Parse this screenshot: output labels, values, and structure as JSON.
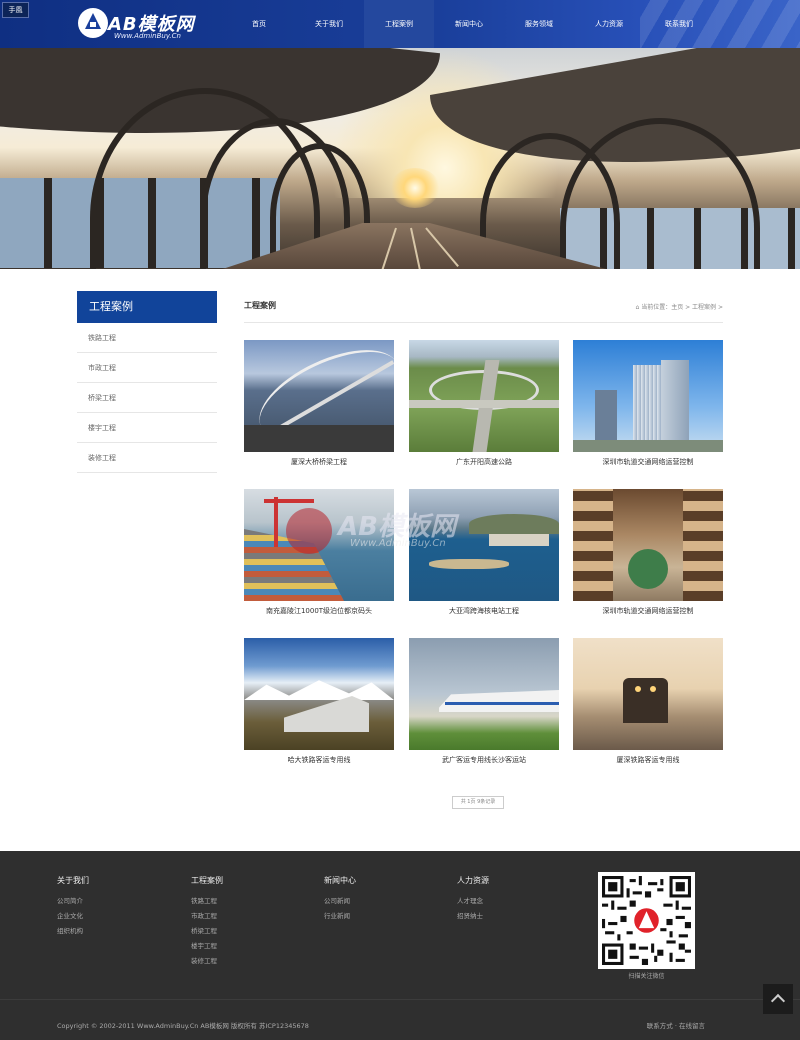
{
  "header": {
    "mobile_menu_label": "手風",
    "logo_name": "AB模板网",
    "logo_url": "Www.AdminBuy.Cn",
    "nav": [
      "首页",
      "关于我们",
      "工程案例",
      "新闻中心",
      "服务领域",
      "人力资源",
      "联系我们"
    ],
    "active_nav": "工程案例",
    "brand_color": "#1a3f9b"
  },
  "sidebar": {
    "title": "工程案例",
    "items": [
      "铁路工程",
      "市政工程",
      "桥梁工程",
      "楼宇工程",
      "装修工程"
    ]
  },
  "content": {
    "title": "工程案例",
    "breadcrumb": "当前位置：主页 > 工程案例 >",
    "cases": [
      "厦深大桥桥梁工程",
      "广东开阳高速公路",
      "深圳市轨道交通网络运营控制",
      "南充嘉陵江1000T级泊位都京码头",
      "大亚湾跨海核电站工程",
      "深圳市轨道交通网络运营控制",
      "哈大铁路客运专用线",
      "武广客运专用线长沙客运站",
      "厦深铁路客运专用线"
    ],
    "more_label": "共 1页 9条记录",
    "watermark_name": "AB模板网",
    "watermark_url": "Www.AdminBuy.Cn"
  },
  "footer": {
    "columns": [
      {
        "title": "关于我们",
        "links": [
          "公司简介",
          "企业文化",
          "组织机构"
        ]
      },
      {
        "title": "工程案例",
        "links": [
          "铁路工程",
          "市政工程",
          "桥梁工程",
          "楼宇工程",
          "装修工程"
        ]
      },
      {
        "title": "新闻中心",
        "links": [
          "公司新闻",
          "行业新闻"
        ]
      },
      {
        "title": "人力资源",
        "links": [
          "人才理念",
          "招贤纳士"
        ]
      }
    ],
    "qr_caption": "扫描关注微信",
    "copyright": "Copyright © 2002-2011 Www.AdminBuy.Cn AB模板网 版权所有   苏ICP12345678",
    "right_links": "联系方式 · 在线留言"
  }
}
